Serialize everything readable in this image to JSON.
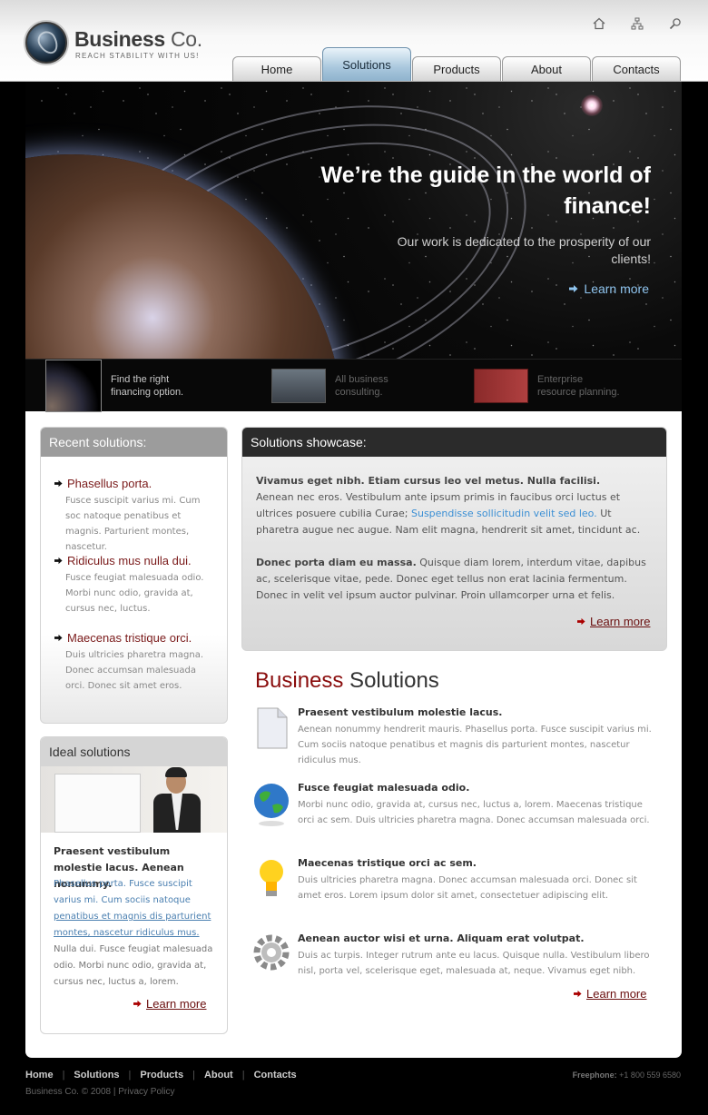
{
  "brand": {
    "name": "Business",
    "name_suffix": " Co.",
    "tagline": "REACH STABILITY WITH US!"
  },
  "top_icons": [
    "home-icon",
    "sitemap-icon",
    "search-icon"
  ],
  "nav": {
    "tabs": [
      "Home",
      "Solutions",
      "Products",
      "About",
      "Contacts"
    ],
    "active": "Solutions"
  },
  "hero": {
    "title": "We’re the guide in the world of finance!",
    "subtitle": "Our work is dedicated to the prosperity of our clients!",
    "link": "Learn more"
  },
  "strip": [
    {
      "text": "Find the right\nfinancing option."
    },
    {
      "text": "All business\nconsulting."
    },
    {
      "text": "Enterprise\nresource planning."
    }
  ],
  "recent": {
    "heading": "Recent solutions:",
    "items": [
      {
        "title": "Phasellus porta.",
        "text": "Fusce suscipit varius mi. Cum soc natoque penatibus et magnis. Parturient montes, nascetur."
      },
      {
        "title": "Ridiculus mus nulla dui.",
        "text": "Fusce feugiat malesuada odio. Morbi nunc odio, gravida at, cursus nec, luctus."
      },
      {
        "title": "Maecenas tristique orci.",
        "text": "Duis ultricies pharetra magna. Donec accumsan malesuada orci. Donec sit amet eros."
      }
    ]
  },
  "ideal": {
    "heading": "Ideal solutions",
    "strong": "Praesent vestibulum molestie lacus. Aenean nonummy.",
    "text_1": "Phasellus porta. Fusce suscipit varius mi. Cum sociis natoque ",
    "text_link": "penatibus et magnis dis parturient montes, nascetur ridiculus mus.",
    "text_2": " Nulla dui. Fusce feugiat malesuada odio. Morbi nunc odio, gravida at, cursus nec, luctus a, lorem.",
    "link": "Learn more"
  },
  "showcase": {
    "heading": "Solutions showcase:",
    "p1_bold": "Vivamus eget nibh. Etiam cursus leo vel metus. Nulla facilisi.",
    "p1_text": "Aenean nec eros. Vestibulum ante ipsum primis in faucibus orci luctus et ultrices posuere cubilia Curae; ",
    "p1_link": "Suspendisse sollicitudin velit sed leo.",
    "p1_text2": " Ut pharetra augue nec augue. Nam elit magna, hendrerit sit amet, tincidunt ac.",
    "p2_bold": "Donec porta diam eu massa.",
    "p2_text": " Quisque diam lorem, interdum vitae, dapibus ac, scelerisque vitae, pede. Donec eget tellus non erat lacinia fermentum. Donec in velit vel ipsum auctor pulvinar. Proin ullamcorper urna et felis.",
    "link": "Learn more"
  },
  "business": {
    "title_red": "Business",
    "title_rest": " Solutions",
    "items": [
      {
        "icon": "document-icon",
        "title": "Praesent vestibulum molestie lacus.",
        "text": "Aenean nonummy hendrerit mauris. Phasellus porta. Fusce suscipit varius mi. Cum sociis natoque penatibus et magnis dis parturient montes, nascetur ridiculus mus."
      },
      {
        "icon": "globe-icon",
        "title": "Fusce feugiat malesuada odio.",
        "text": "Morbi nunc odio, gravida at, cursus nec, luctus a, lorem. Maecenas tristique orci ac sem. Duis ultricies pharetra magna. Donec accumsan malesuada orci."
      },
      {
        "icon": "lightbulb-icon",
        "title": "Maecenas tristique orci ac sem.",
        "text": "Duis ultricies pharetra magna. Donec accumsan malesuada orci. Donec sit amet eros. Lorem ipsum dolor sit amet, consectetuer adipiscing elit."
      },
      {
        "icon": "gear-icon",
        "title": "Aenean auctor wisi et urna. Aliquam erat volutpat.",
        "text": "Duis ac turpis. Integer rutrum ante eu lacus. Quisque nulla. Vestibulum libero nisl, porta vel, scelerisque eget, malesuada at, neque. Vivamus eget nibh."
      }
    ],
    "link": "Learn more"
  },
  "footer": {
    "links": [
      "Home",
      "Solutions",
      "Products",
      "About",
      "Contacts"
    ],
    "copyright": "Business Co. © 2008 | Privacy Policy",
    "phone_label": "Freephone:",
    "phone": " +1 800 559 6580"
  },
  "colors": {
    "accent_red": "#8a0d0d",
    "link_blue": "#3b8fd4",
    "nav_active": "#a9c7dd"
  }
}
